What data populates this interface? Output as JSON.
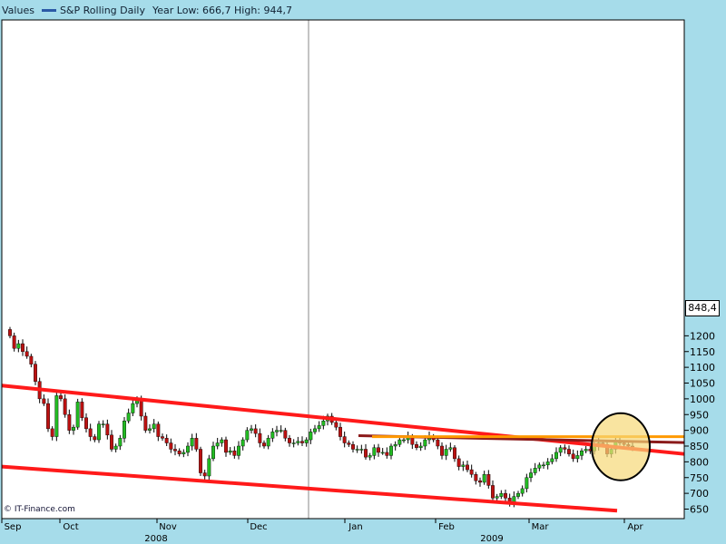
{
  "header": {
    "values_label": "Values",
    "series_name": "S&P Rolling Daily",
    "range_text": "Year Low: 666,7  High: 944,7"
  },
  "credit": "© IT-Finance.com",
  "last_price_label": "848,4",
  "colors": {
    "background": "#a6dcea",
    "plot_bg": "#ffffff",
    "up_candle": "#22bb22",
    "down_candle": "#bb1111",
    "channel": "#ff1a1a",
    "trend_dark": "#8b1a1a",
    "resistance": "#ff9900",
    "highlight_fill": "#f6d978"
  },
  "chart_data": {
    "type": "candlestick",
    "title": "S&P Rolling Daily",
    "y_ticks": [
      650,
      700,
      750,
      800,
      850,
      900,
      950,
      1000,
      1050,
      1100,
      1150,
      1200
    ],
    "ylim": [
      645,
      1228
    ],
    "x_ticks": [
      "Sep",
      "Oct",
      "Nov",
      "Dec",
      "Jan",
      "Feb",
      "Mar",
      "Apr"
    ],
    "year_labels": [
      {
        "label": "2008",
        "month": "Nov"
      },
      {
        "label": "2009",
        "month": "Feb"
      }
    ],
    "grid": "vertical line at year boundary",
    "closes": [
      1200,
      1160,
      1175,
      1150,
      1135,
      1110,
      1055,
      1000,
      985,
      905,
      880,
      1010,
      1000,
      950,
      900,
      910,
      990,
      940,
      905,
      880,
      870,
      920,
      920,
      885,
      840,
      850,
      875,
      930,
      955,
      985,
      1000,
      945,
      900,
      905,
      920,
      880,
      875,
      860,
      840,
      835,
      825,
      830,
      850,
      875,
      840,
      765,
      755,
      810,
      850,
      860,
      870,
      830,
      835,
      820,
      850,
      870,
      900,
      905,
      890,
      860,
      850,
      875,
      895,
      900,
      900,
      875,
      860,
      860,
      865,
      860,
      870,
      895,
      905,
      915,
      930,
      945,
      925,
      910,
      880,
      860,
      855,
      840,
      840,
      840,
      815,
      820,
      845,
      830,
      830,
      820,
      850,
      855,
      870,
      870,
      880,
      855,
      845,
      850,
      870,
      880,
      870,
      850,
      820,
      840,
      845,
      810,
      785,
      790,
      775,
      760,
      740,
      735,
      760,
      725,
      685,
      690,
      700,
      685,
      670,
      690,
      700,
      715,
      750,
      765,
      780,
      790,
      790,
      800,
      810,
      830,
      845,
      840,
      825,
      810,
      820,
      835,
      840,
      835,
      850,
      860,
      855,
      825,
      840,
      865,
      860,
      855,
      850,
      848
    ],
    "resistance_level": 880,
    "annotations": [
      "descending channel",
      "trendline",
      "highlighted current zone"
    ]
  }
}
